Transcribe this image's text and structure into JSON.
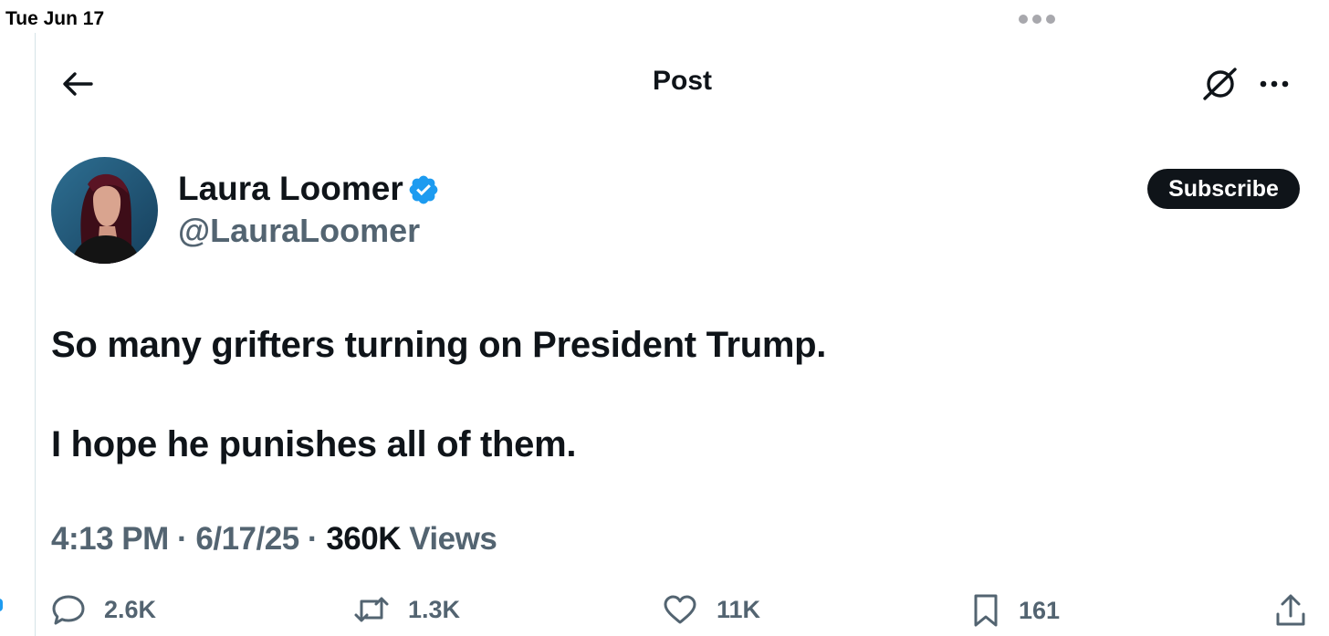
{
  "status_bar": {
    "date": "Tue Jun 17"
  },
  "header": {
    "title": "Post"
  },
  "author": {
    "display_name": "Laura Loomer",
    "handle": "@LauraLoomer",
    "verified": true,
    "avatar_icon": "profile-photo"
  },
  "actions": {
    "subscribe_label": "Subscribe"
  },
  "tweet": {
    "lines": [
      "So many grifters turning on President Trump.",
      "I hope he punishes all of them."
    ]
  },
  "meta": {
    "time": "4:13 PM",
    "separator": "·",
    "date": "6/17/25",
    "views_count": "360K",
    "views_label": "Views"
  },
  "engagement": {
    "replies": "2.6K",
    "reposts": "1.3K",
    "likes": "11K",
    "bookmarks": "161"
  },
  "colors": {
    "text_primary": "#0f1419",
    "text_secondary": "#536471",
    "verified_blue": "#1d9bf0",
    "button_dark": "#0f1419"
  },
  "icons": [
    "back-arrow-icon",
    "grok-icon",
    "more-icon",
    "verified-icon",
    "reply-icon",
    "repost-icon",
    "like-icon",
    "bookmark-icon",
    "share-icon"
  ]
}
